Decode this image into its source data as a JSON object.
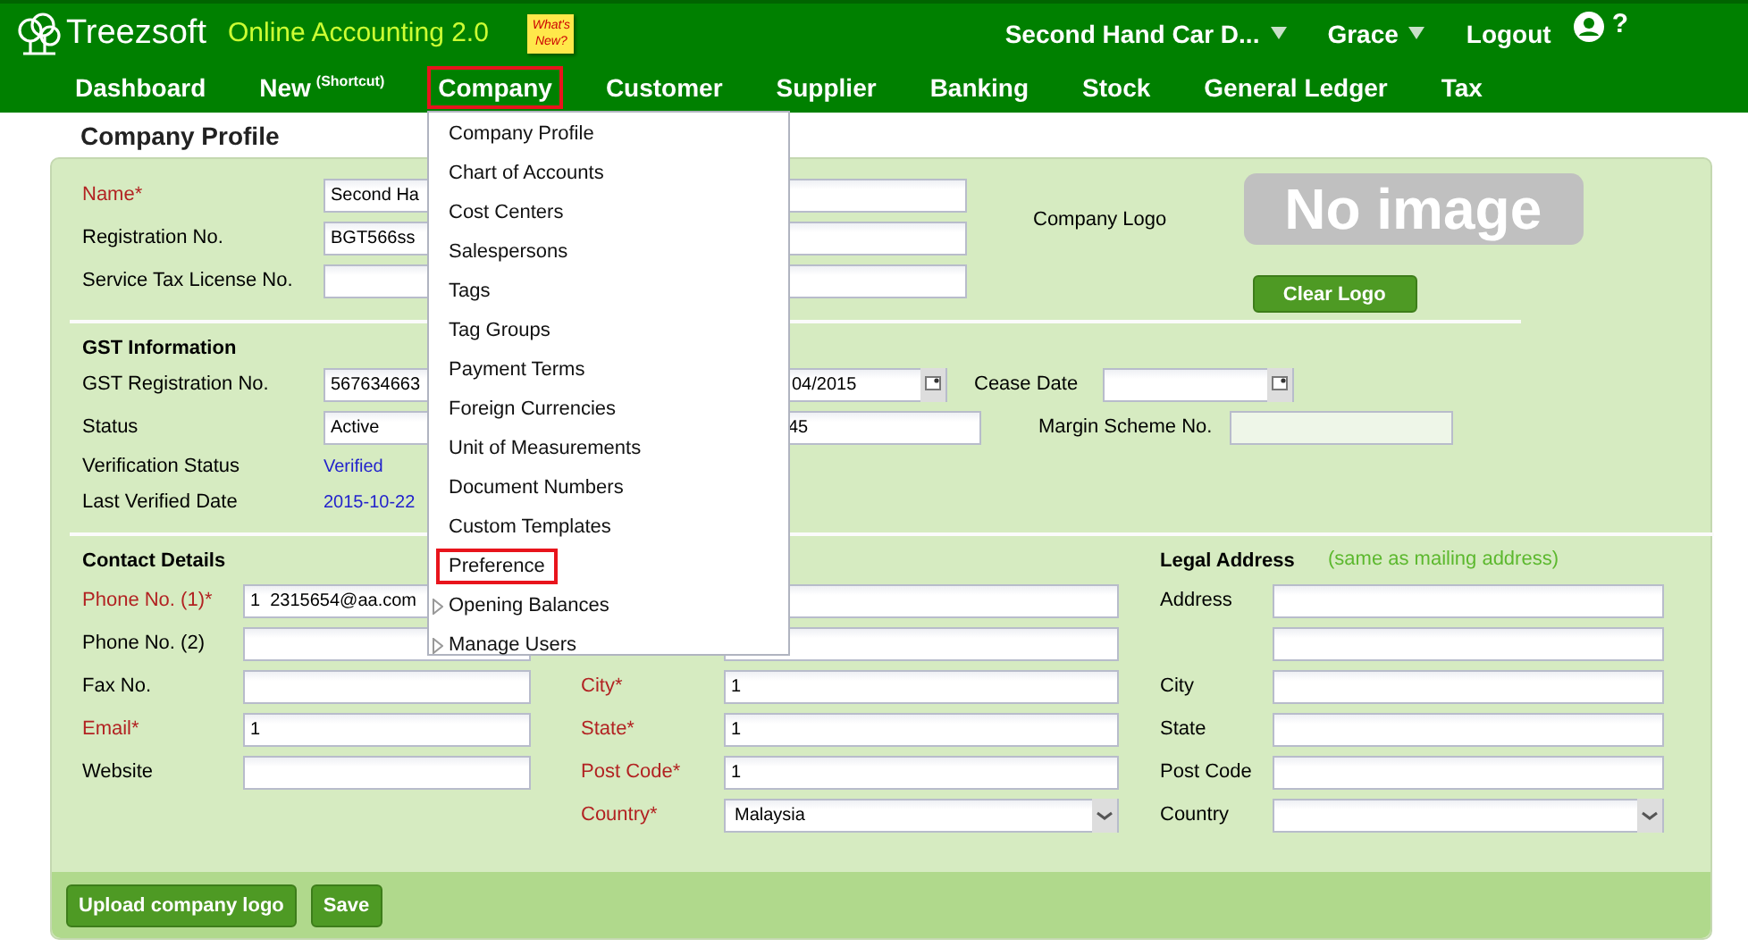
{
  "header": {
    "brand": "Treezsoft",
    "product": "Online Accounting 2.0",
    "note": "What's New?",
    "company": "Second Hand Car D...",
    "user": "Grace",
    "logout": "Logout",
    "help": "?"
  },
  "nav": [
    {
      "label": "Dashboard",
      "selected": false
    },
    {
      "label": "New",
      "sup": "(Shortcut)",
      "selected": false
    },
    {
      "label": "Company",
      "selected": true
    },
    {
      "label": "Customer",
      "selected": false
    },
    {
      "label": "Supplier",
      "selected": false
    },
    {
      "label": "Banking",
      "selected": false
    },
    {
      "label": "Stock",
      "selected": false
    },
    {
      "label": "General Ledger",
      "selected": false
    },
    {
      "label": "Tax",
      "selected": false
    }
  ],
  "menu": [
    {
      "label": "Company Profile",
      "kind": "link",
      "selected": false
    },
    {
      "label": "Chart of Accounts",
      "kind": "link",
      "selected": false
    },
    {
      "label": "Cost Centers",
      "kind": "link",
      "selected": false
    },
    {
      "label": "Salespersons",
      "kind": "link",
      "selected": false
    },
    {
      "label": "Tags",
      "kind": "link",
      "selected": false
    },
    {
      "label": "Tag Groups",
      "kind": "link",
      "selected": false
    },
    {
      "label": "Payment Terms",
      "kind": "link",
      "selected": false
    },
    {
      "label": "Foreign Currencies",
      "kind": "link",
      "selected": false
    },
    {
      "label": "Unit of Measurements",
      "kind": "link",
      "selected": false
    },
    {
      "label": "Document Numbers",
      "kind": "link",
      "selected": false
    },
    {
      "label": "Custom Templates",
      "kind": "link",
      "selected": false
    },
    {
      "label": "Preference",
      "kind": "link",
      "selected": true
    },
    {
      "label": "Opening Balances",
      "kind": "submenu",
      "selected": false
    },
    {
      "label": "Manage Users",
      "kind": "submenu",
      "selected": false
    }
  ],
  "page_title": "Company Profile",
  "general": {
    "fields": [
      {
        "label": "Name*",
        "required": true,
        "value": "Second Ha"
      },
      {
        "label": "Registration No.",
        "required": false,
        "value": "BGT566ss"
      },
      {
        "label": "Service Tax License No.",
        "required": false
      }
    ],
    "logo": {
      "label": "Company Logo",
      "image_text": "No image",
      "button": "Clear Logo"
    }
  },
  "gst": {
    "title": "GST Information",
    "registration": {
      "label": "GST Registration No.",
      "value": "567634663"
    },
    "date_field": {
      "value": "04/2015"
    },
    "cease": {
      "label": "Cease Date"
    },
    "status": {
      "label": "Status",
      "value": "Active"
    },
    "number_field": {
      "value": "45"
    },
    "margin": {
      "label": "Margin Scheme No.",
      "disabled": true
    },
    "verification": {
      "label": "Verification Status",
      "value": "Verified"
    },
    "last_verified": {
      "label": "Last Verified Date",
      "value": "2015-10-22"
    }
  },
  "contact": {
    "title": "Contact Details",
    "fields": [
      {
        "label": "Phone No. (1)*",
        "required": true,
        "value": "1  2315654@aa.com"
      },
      {
        "label": "Phone No. (2)",
        "required": false
      },
      {
        "label": "Fax No.",
        "required": false
      },
      {
        "label": "Email*",
        "required": true,
        "value": "1"
      },
      {
        "label": "Website",
        "required": false
      }
    ]
  },
  "mailing": {
    "fields": [
      {
        "kind": "text"
      },
      {
        "kind": "text"
      },
      {
        "kind": "text",
        "label": "City*",
        "required": true,
        "value": "1"
      },
      {
        "kind": "text",
        "label": "State*",
        "required": true,
        "value": "1"
      },
      {
        "kind": "text",
        "label": "Post Code*",
        "required": true,
        "value": "1"
      },
      {
        "kind": "select",
        "label": "Country*",
        "required": true,
        "value": "Malaysia"
      }
    ]
  },
  "legal": {
    "title": "Legal Address",
    "note": "(same as mailing address)",
    "fields": [
      {
        "kind": "text",
        "label": "Address",
        "required": false
      },
      {
        "kind": "text"
      },
      {
        "kind": "text",
        "label": "City",
        "required": false
      },
      {
        "kind": "text",
        "label": "State",
        "required": false
      },
      {
        "kind": "text",
        "label": "Post Code",
        "required": false
      },
      {
        "kind": "select",
        "label": "Country",
        "required": false
      }
    ]
  },
  "footer_buttons": [
    "Upload company logo",
    "Save"
  ]
}
